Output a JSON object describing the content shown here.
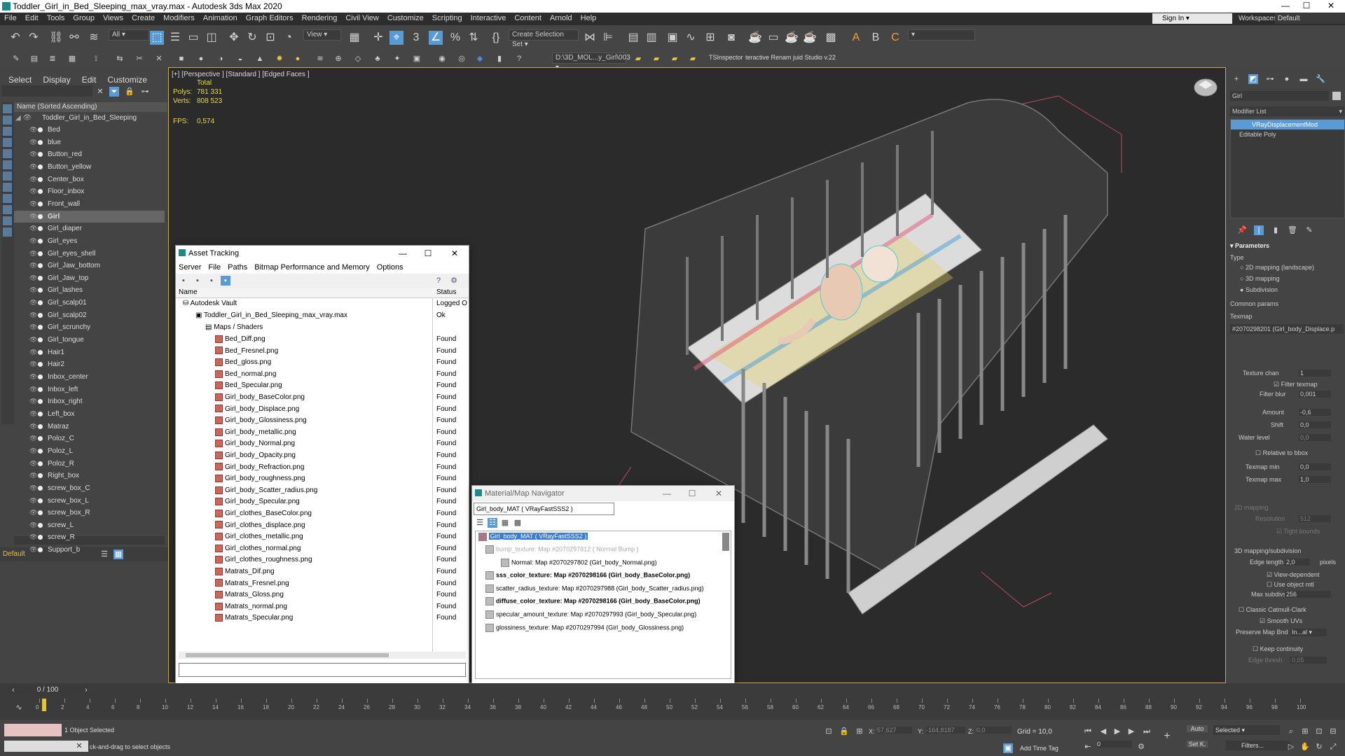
{
  "window": {
    "title": "Toddler_Girl_in_Bed_Sleeping_max_vray.max - Autodesk 3ds Max 2020",
    "controls": [
      "—",
      "☐",
      "✕"
    ]
  },
  "menu": [
    "File",
    "Edit",
    "Tools",
    "Group",
    "Views",
    "Create",
    "Modifiers",
    "Animation",
    "Graph Editors",
    "Rendering",
    "Civil View",
    "Customize",
    "Scripting",
    "Interactive",
    "Content",
    "Arnold",
    "Help"
  ],
  "toolbar": {
    "filter": "All",
    "view": "View",
    "selection_set": "Create Selection Set",
    "sign_in": "Sign In",
    "workspaces_label": "Workspaces:",
    "workspace": "Default",
    "path": "D:\\3D_MOL...y_Girl\\003",
    "ts_inspector": "TSInspector",
    "renam": "teractive Renam juid Studio v.22"
  },
  "scene_explorer": {
    "tabs": [
      "Select",
      "Display",
      "Edit",
      "Customize"
    ],
    "header": "Name (Sorted Ascending)",
    "root": "Toddler_Girl_in_Bed_Sleeping",
    "items": [
      "Bed",
      "blue",
      "Button_red",
      "Button_yellow",
      "Center_box",
      "Floor_inbox",
      "Front_wall",
      "Girl",
      "Girl_diaper",
      "Girl_eyes",
      "Girl_eyes_shell",
      "Girl_Jaw_bottom",
      "Girl_Jaw_top",
      "Girl_lashes",
      "Girl_scalp01",
      "Girl_scalp02",
      "Girl_scrunchy",
      "Girl_tongue",
      "Hair1",
      "Hair2",
      "Inbox_center",
      "Inbox_left",
      "Inbox_right",
      "Left_box",
      "Matraz",
      "Poloz_C",
      "Poloz_L",
      "Poloz_R",
      "Right_box",
      "screw_box_C",
      "screw_box_L",
      "screw_box_R",
      "screw_L",
      "screw_R",
      "Support_b"
    ],
    "selected": "Girl",
    "layer": "Default"
  },
  "viewport": {
    "label": "[+] [Perspective ] [Standard ] [Edged Faces ]",
    "total_label": "Total",
    "polys_label": "Polys:",
    "polys": "781 331",
    "verts_label": "Verts:",
    "verts": "808 523",
    "fps_label": "FPS:",
    "fps": "0,574"
  },
  "asset_tracking": {
    "title": "Asset Tracking",
    "menu": [
      "Server",
      "File",
      "Paths",
      "Bitmap Performance and Memory",
      "Options"
    ],
    "col_name": "Name",
    "col_status": "Status",
    "vault": "Autodesk Vault",
    "vault_status": "Logged O",
    "file": "Toddler_Girl_in_Bed_Sleeping_max_vray.max",
    "file_status": "Ok",
    "group": "Maps / Shaders",
    "maps": [
      "Bed_Diff.png",
      "Bed_Fresnel.png",
      "Bed_gloss.png",
      "Bed_normal.png",
      "Bed_Specular.png",
      "Girl_body_BaseColor.png",
      "Girl_body_Displace.png",
      "Girl_body_Glossiness.png",
      "Girl_body_metallic.png",
      "Girl_body_Normal.png",
      "Girl_body_Opacity.png",
      "Girl_body_Refraction.png",
      "Girl_body_roughness.png",
      "Girl_body_Scatter_radius.png",
      "Girl_body_Specular.png",
      "Girl_clothes_BaseColor.png",
      "Girl_clothes_displace.png",
      "Girl_clothes_metallic.png",
      "Girl_clothes_normal.png",
      "Girl_clothes_roughness.png",
      "Matrats_Dif.png",
      "Matrats_Fresnel.png",
      "Matrats_Gloss.png",
      "Matrats_normal.png",
      "Matrats_Specular.png"
    ],
    "found": "Found"
  },
  "material_nav": {
    "title": "Material/Map Navigator",
    "field": "Girl_body_MAT  ( VRayFastSSS2 )",
    "root": "Girl_body_MAT  ( VRayFastSSS2 )",
    "items": [
      {
        "text": "bump_texture: Map #2070297812  ( Normal Bump )",
        "style": "dim"
      },
      {
        "text": "Normal: Map #2070297802 (Girl_body_Normal.png)",
        "style": "normal"
      },
      {
        "text": "sss_color_texture: Map #2070298166 (Girl_body_BaseColor.png)",
        "style": "bold"
      },
      {
        "text": "scatter_radius_texture: Map #2070297988 (Girl_body_Scatter_radius.png)",
        "style": "normal"
      },
      {
        "text": "diffuse_color_texture: Map #2070298166 (Girl_body_BaseColor.png)",
        "style": "bold"
      },
      {
        "text": "specular_amount_texture: Map #2070297993 (Girl_body_Specular.png)",
        "style": "normal"
      },
      {
        "text": "glossiness_texture: Map #2070297994 (Girl_body_Glossiness.png)",
        "style": "normal"
      }
    ]
  },
  "command_panel": {
    "object_name": "Girl",
    "modifier_list": "Modifier List",
    "stack": [
      "VRayDisplacementMod",
      "Editable Poly"
    ],
    "parameters": "Parameters",
    "type_label": "Type",
    "types": [
      "2D mapping (landscape)",
      "3D mapping",
      "Subdivision"
    ],
    "common_params": "Common params",
    "texmap_label": "Texmap",
    "texmap": "#2070298201 (Girl_body_Displace.p",
    "texture_chan_label": "Texture chan",
    "texture_chan": "1",
    "filter_texmap": "Filter texmap",
    "filter_blur_label": "Filter blur",
    "filter_blur": "0,001",
    "amount_label": "Amount",
    "amount": "-0,6",
    "shift_label": "Shift",
    "shift": "0,0",
    "water_label": "Water level",
    "water": "0,0",
    "relative": "Relative to bbox",
    "texmap_min_label": "Texmap min",
    "texmap_min": "0,0",
    "texmap_max_label": "Texmap max",
    "texmap_max": "1,0",
    "mapping2d": "2D mapping",
    "resolution_label": "Resolution",
    "resolution": "512",
    "tight": "Tight bounds",
    "mapping3d": "3D mapping/subdivision",
    "edge_length_label": "Edge length",
    "edge_length": "2,0",
    "pixels": "pixels",
    "view_dependent": "View-dependent",
    "use_object_mtl": "Use object mtl",
    "max_subdivs_label": "Max subdivs",
    "max_subdivs": "256",
    "catmull": "Classic Catmull-Clark",
    "smooth_uvs": "Smooth UVs",
    "preserve_label": "Preserve Map Bnd",
    "preserve": "In...al",
    "keep_continuity": "Keep continuity",
    "edge_thresh_label": "Edge thresh",
    "edge_thresh": "0,05"
  },
  "timeline": {
    "frame": "0 / 100",
    "ticks": [
      "0",
      "2",
      "4",
      "6",
      "8",
      "10",
      "12",
      "14",
      "16",
      "18",
      "20",
      "22",
      "24",
      "26",
      "28",
      "30",
      "32",
      "34",
      "36",
      "38",
      "40",
      "42",
      "44",
      "46",
      "48",
      "50",
      "52",
      "54",
      "56",
      "58",
      "60",
      "62",
      "64",
      "66",
      "68",
      "70",
      "72",
      "74",
      "76",
      "78",
      "80",
      "82",
      "84",
      "86",
      "88",
      "90",
      "92",
      "94",
      "96",
      "98",
      "100"
    ]
  },
  "status": {
    "selected": "1 Object Selected",
    "prompt": "ck-and-drag to select objects",
    "x_label": "X:",
    "x": "57,627",
    "y_label": "Y:",
    "y": "-164,8187",
    "z_label": "Z:",
    "z": "0,0",
    "grid": "Grid = 10,0",
    "add_time_tag": "Add Time Tag",
    "auto": "Auto",
    "set_k": "Set K.",
    "selected_dd": "Selected",
    "filters": "Filters...",
    "frame_field": "0"
  }
}
